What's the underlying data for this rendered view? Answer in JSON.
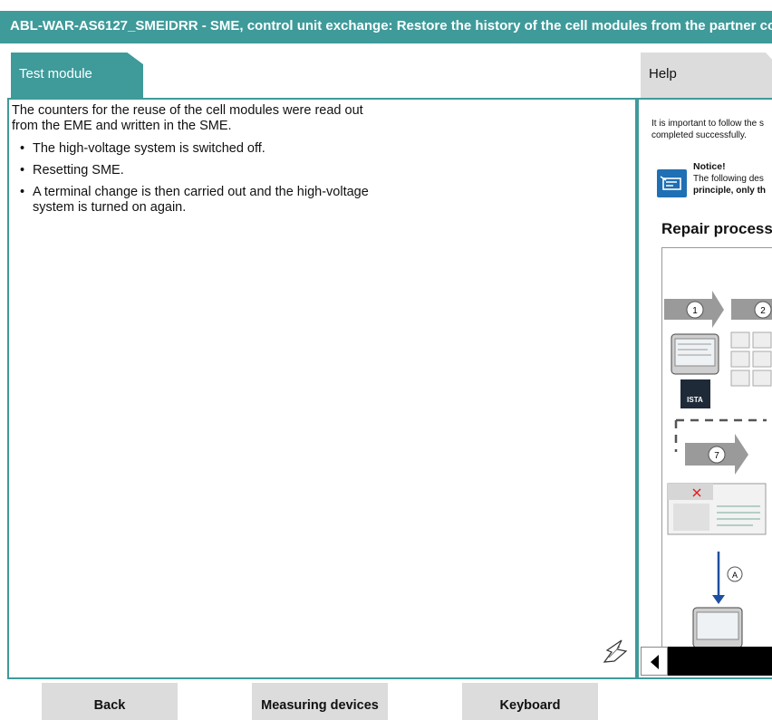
{
  "window": {
    "title": "ABL-WAR-AS6127_SMEIDRR - SME, control unit exchange: Restore the history of the cell modules from the partner co"
  },
  "tabs": {
    "test_module": "Test module",
    "help": "Help"
  },
  "content": {
    "intro": "The counters for the reuse of the cell modules were read out from the EME and written in the SME.",
    "bullets": [
      "The high-voltage system is switched off.",
      "Resetting SME.",
      "A terminal change is then carried out and the high-voltage system is turned on again."
    ]
  },
  "help_panel": {
    "text_line1": "It is important to follow the s",
    "text_line2": "completed successfully.",
    "notice_title": "Notice!",
    "notice_line1": "The following des",
    "notice_line2": "principle, only th",
    "repair_title": "Repair process",
    "diagram": {
      "step1": "1",
      "step2": "2",
      "step7": "7",
      "stepA": "A",
      "logo": "ISTA"
    }
  },
  "buttons": {
    "back": "Back",
    "measuring_devices": "Measuring devices",
    "keyboard": "Keyboard"
  },
  "icons": {
    "cursor": "busy-cursor-icon",
    "notice": "hand-pointing-icon",
    "scroll_left": "triangle-left-icon"
  },
  "colors": {
    "accent": "#3f9a9a",
    "notice_blue": "#1f6fb4",
    "tab_inactive": "#dcdcdc"
  }
}
